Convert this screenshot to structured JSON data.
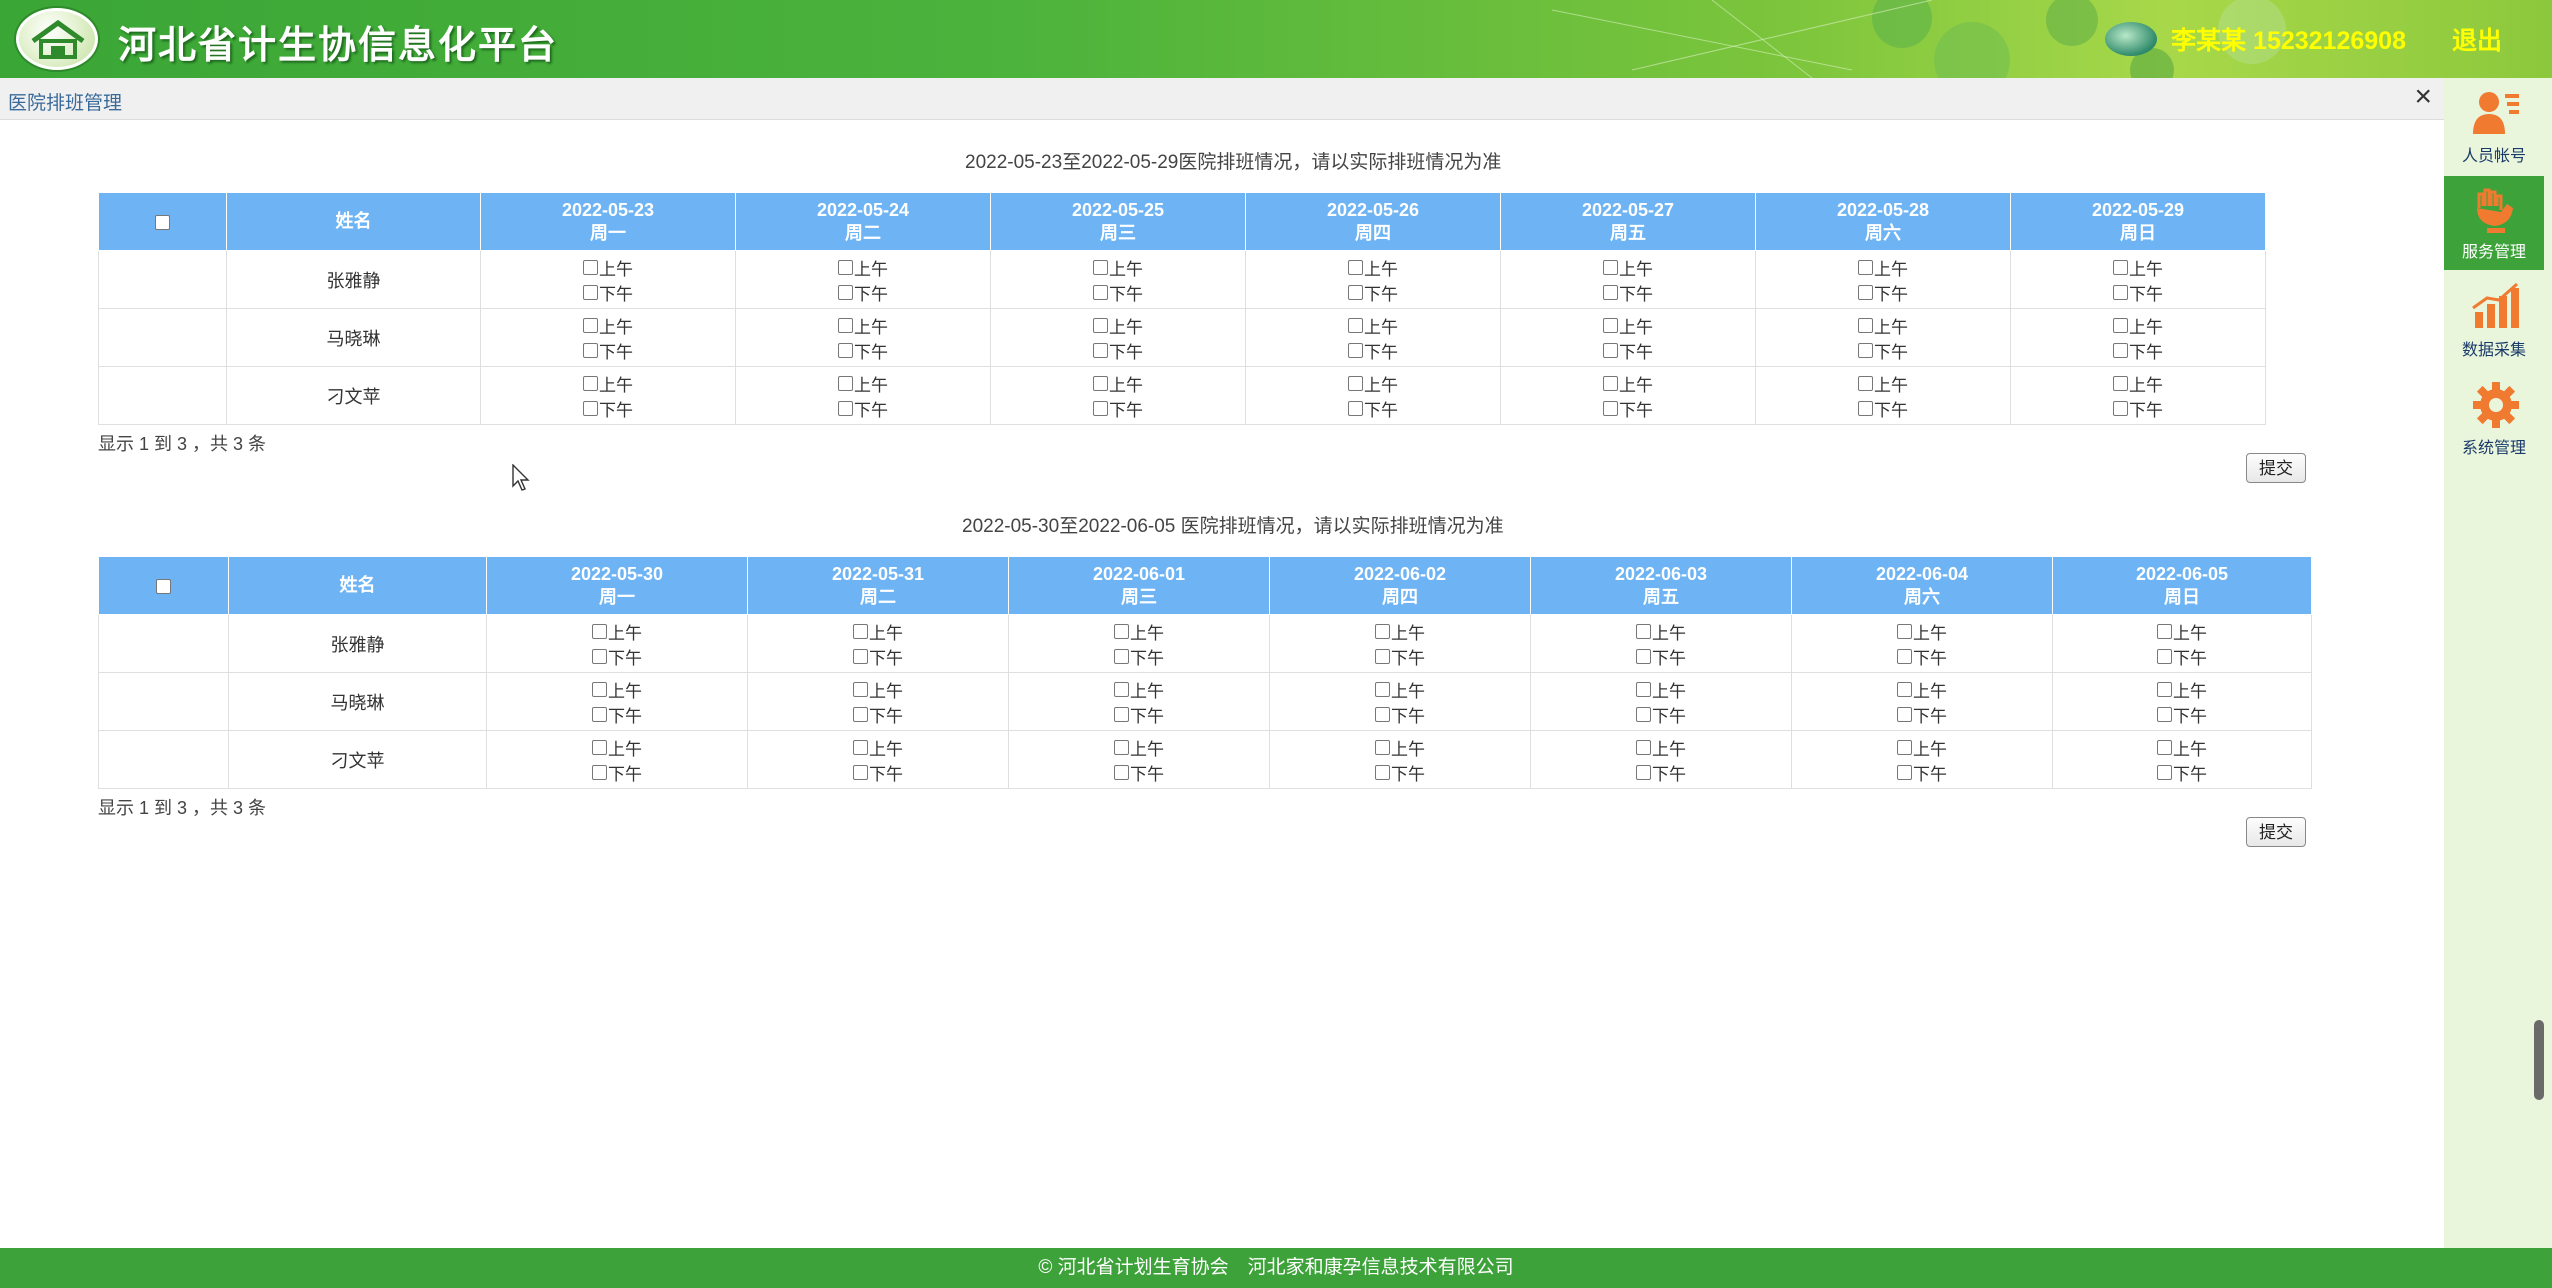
{
  "header": {
    "title": "河北省计生协信息化平台",
    "user": "李某某 15232126908",
    "logout": "退出"
  },
  "tab": {
    "title": "医院排班管理",
    "close": "×"
  },
  "sidebar": {
    "items": [
      {
        "label": "人员帐号",
        "icon": "user-account-icon",
        "active": false
      },
      {
        "label": "服务管理",
        "icon": "service-hand-icon",
        "active": true
      },
      {
        "label": "数据采集",
        "icon": "chart-icon",
        "active": false
      },
      {
        "label": "系统管理",
        "icon": "gear-icon",
        "active": false
      }
    ]
  },
  "shift_labels": {
    "am": "上午",
    "pm": "下午"
  },
  "name_header": "姓名",
  "weeks": [
    {
      "caption": "2022-05-23至2022-05-29医院排班情况，请以实际排班情况为准",
      "days": [
        {
          "date": "2022-05-23",
          "weekday": "周一"
        },
        {
          "date": "2022-05-24",
          "weekday": "周二"
        },
        {
          "date": "2022-05-25",
          "weekday": "周三"
        },
        {
          "date": "2022-05-26",
          "weekday": "周四"
        },
        {
          "date": "2022-05-27",
          "weekday": "周五"
        },
        {
          "date": "2022-05-28",
          "weekday": "周六"
        },
        {
          "date": "2022-05-29",
          "weekday": "周日"
        }
      ],
      "rows": [
        "张雅静",
        "马晓琳",
        "刁文苹"
      ],
      "count": "显示 1 到 3 ，共 3 条",
      "submit": "提交"
    },
    {
      "caption": "2022-05-30至2022-06-05 医院排班情况，请以实际排班情况为准",
      "days": [
        {
          "date": "2022-05-30",
          "weekday": "周一"
        },
        {
          "date": "2022-05-31",
          "weekday": "周二"
        },
        {
          "date": "2022-06-01",
          "weekday": "周三"
        },
        {
          "date": "2022-06-02",
          "weekday": "周四"
        },
        {
          "date": "2022-06-03",
          "weekday": "周五"
        },
        {
          "date": "2022-06-04",
          "weekday": "周六"
        },
        {
          "date": "2022-06-05",
          "weekday": "周日"
        }
      ],
      "rows": [
        "张雅静",
        "马晓琳",
        "刁文苹"
      ],
      "count": "显示 1 到 3 ，共 3 条",
      "submit": "提交"
    }
  ],
  "footer": "© 河北省计划生育协会　河北家和康孕信息技术有限公司"
}
